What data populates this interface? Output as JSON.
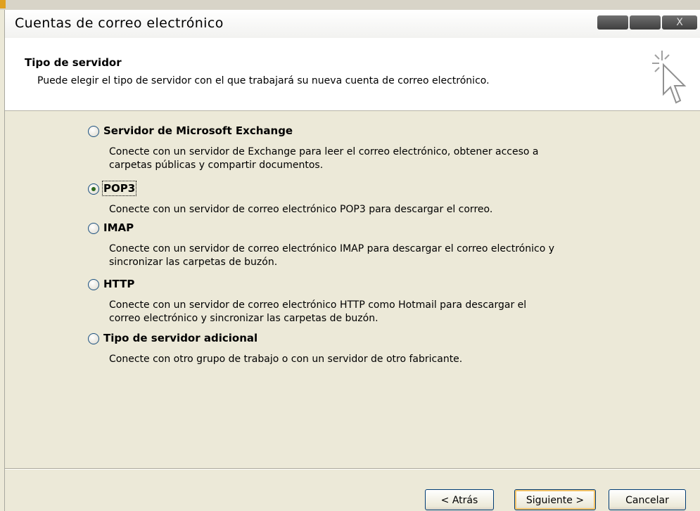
{
  "window": {
    "title": "Cuentas de correo electrónico",
    "close_glyph": "X"
  },
  "header": {
    "title": "Tipo de servidor",
    "description": "Puede elegir el tipo de servidor con el que trabajará su nueva cuenta de correo electrónico."
  },
  "options": [
    {
      "label": "Servidor de Microsoft Exchange",
      "description": "Conecte con un servidor de Exchange para leer el correo electrónico, obtener acceso a carpetas públicas y compartir documentos.",
      "selected": false
    },
    {
      "label": "POP3",
      "description": "Conecte con un servidor de correo electrónico POP3 para descargar el correo.",
      "selected": true
    },
    {
      "label": "IMAP",
      "description": "Conecte con un servidor de correo electrónico IMAP para descargar el correo electrónico y sincronizar las carpetas de buzón.",
      "selected": false
    },
    {
      "label": "HTTP",
      "description": "Conecte con un servidor de correo electrónico HTTP como Hotmail para descargar el correo electrónico y sincronizar las carpetas de buzón.",
      "selected": false
    },
    {
      "label": "Tipo de servidor adicional",
      "description": "Conecte con otro grupo de trabajo o con un servidor de otro fabricante.",
      "selected": false
    }
  ],
  "buttons": {
    "back": "< Atrás",
    "next": "Siguiente >",
    "cancel": "Cancelar"
  },
  "icons": {
    "wizard": "cursor-sparkle-icon"
  }
}
